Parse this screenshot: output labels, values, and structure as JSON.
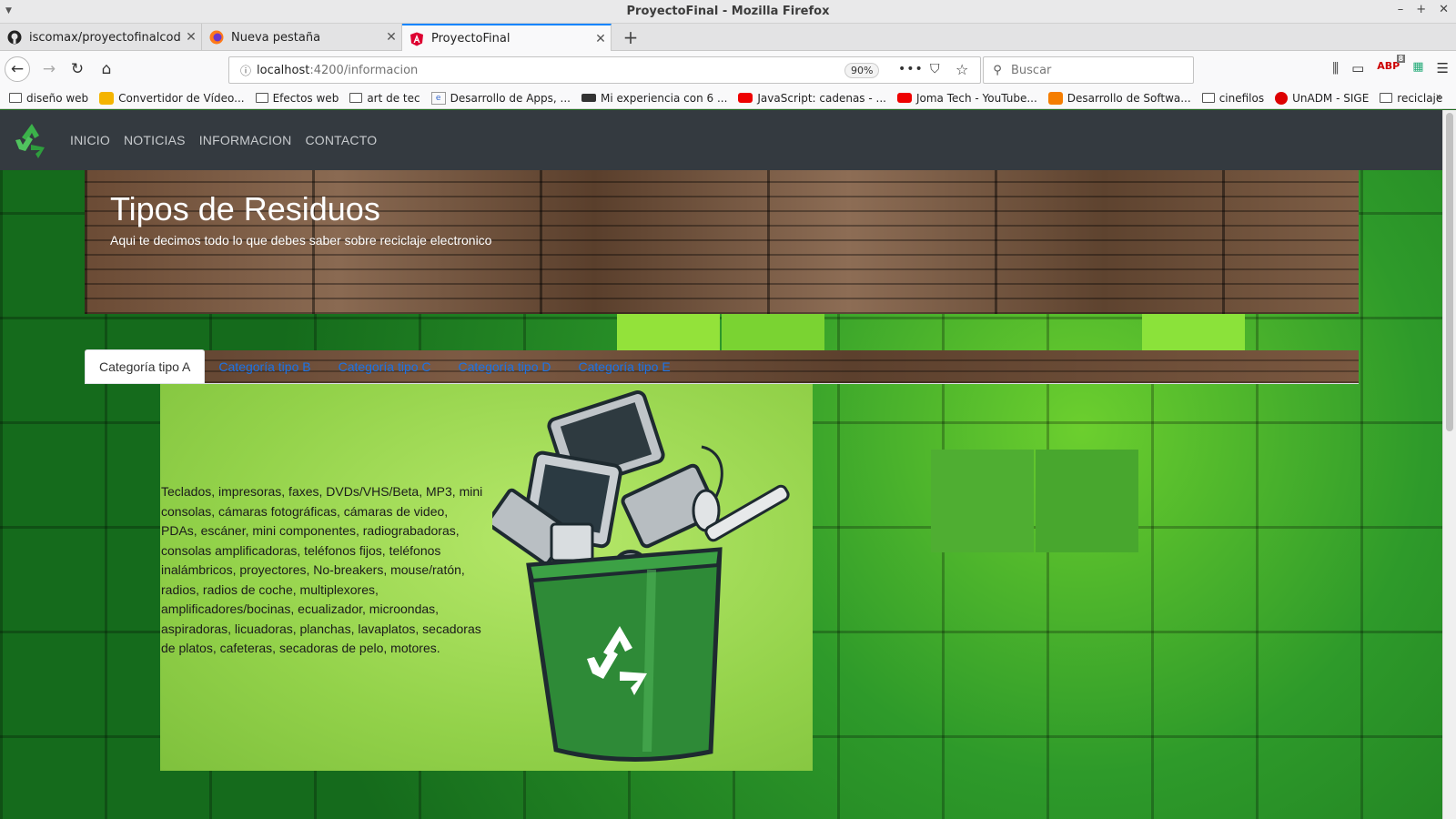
{
  "window": {
    "title": "ProyectoFinal - Mozilla Firefox"
  },
  "tabs": [
    {
      "label": "iscomax/proyectofinalcodean",
      "icon": "github-icon"
    },
    {
      "label": "Nueva pestaña",
      "icon": "firefox-icon"
    },
    {
      "label": "ProyectoFinal",
      "icon": "angular-icon"
    }
  ],
  "urlbar": {
    "host": "localhost",
    "path": ":4200/informacion",
    "zoom": "90%"
  },
  "search": {
    "placeholder": "Buscar"
  },
  "bookmarks": [
    {
      "label": "diseño web",
      "icon": "folder-icon"
    },
    {
      "label": "Convertidor de Vídeo...",
      "icon": "converter-icon"
    },
    {
      "label": "Efectos web",
      "icon": "folder-icon"
    },
    {
      "label": "art de tec",
      "icon": "folder-icon"
    },
    {
      "label": "Desarrollo de Apps, ...",
      "icon": "eo-icon"
    },
    {
      "label": "Mi experiencia con 6 ...",
      "icon": "video-icon"
    },
    {
      "label": "JavaScript: cadenas - ...",
      "icon": "youtube-icon"
    },
    {
      "label": "Joma Tech - YouTube...",
      "icon": "youtube-icon"
    },
    {
      "label": "Desarrollo de Softwa...",
      "icon": "blogger-icon"
    },
    {
      "label": "cinefilos",
      "icon": "folder-icon"
    },
    {
      "label": "UnADM - SIGE",
      "icon": "unadm-icon"
    },
    {
      "label": "reciclaje",
      "icon": "folder-icon"
    }
  ],
  "toolbar": {
    "adblock_count": "8"
  },
  "site": {
    "nav": [
      "INICIO",
      "NOTICIAS",
      "INFORMACION",
      "CONTACTO"
    ],
    "jumbotron": {
      "title": "Tipos de Residuos",
      "subtitle": "Aqui te decimos todo lo que debes saber sobre reciclaje electronico"
    },
    "category_tabs": [
      "Categoría tipo A",
      "Categoría tipo B",
      "Categoría tipo C",
      "Categoría tipo D",
      "Categoría tipo E"
    ],
    "active_tab": 0,
    "content_text": "Teclados, impresoras, faxes, DVDs/VHS/Beta, MP3, mini consolas, cámaras fotográficas, cámaras de video, PDAs, escáner, mini componentes, radiograbadoras, consolas amplificadoras, teléfonos fijos, teléfonos inalámbricos, proyectores, No-breakers, mouse/ratón, radios, radios de coche, multiplexores, amplificadores/bocinas, ecualizador, microondas, aspiradoras, licuadoras, planchas, lavaplatos, secadoras de platos, cafeteras, secadoras de pelo, motores."
  },
  "colors": {
    "nav_bg": "#343a40",
    "link": "#1a73e8",
    "panel": "#9ad452",
    "accent_tab": "#0a84ff"
  }
}
